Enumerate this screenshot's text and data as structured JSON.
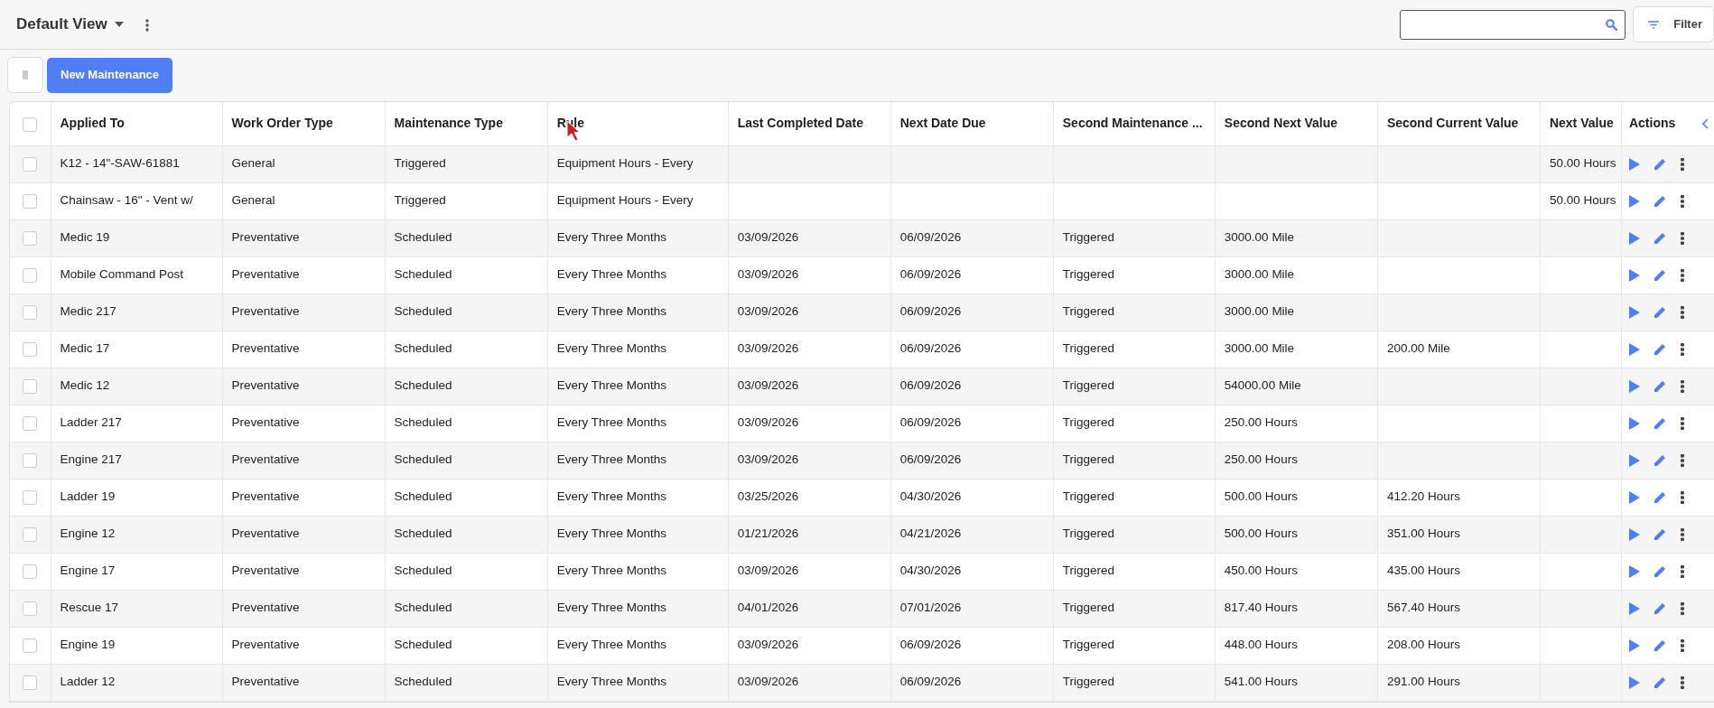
{
  "view": {
    "title": "Default View"
  },
  "filter_button": "Filter",
  "new_button": "New Maintenance",
  "table": {
    "all_selected": false,
    "columns": [
      "Applied To",
      "Work Order Type",
      "Maintenance Type",
      "Rule",
      "Last Completed Date",
      "Next Date Due",
      "Second Maintenance ...",
      "Second Next Value",
      "Second Current Value",
      "Next Value"
    ],
    "actions_header": "Actions",
    "rows": [
      {
        "selected": false,
        "cells": [
          "K12 - 14\"-SAW-61881",
          "General",
          "Triggered",
          "Equipment Hours - Every",
          null,
          null,
          null,
          null,
          null,
          "50.00 Hours"
        ]
      },
      {
        "selected": false,
        "cells": [
          "Chainsaw - 16\" - Vent w/",
          "General",
          "Triggered",
          "Equipment Hours - Every",
          null,
          null,
          null,
          null,
          null,
          "50.00 Hours"
        ]
      },
      {
        "selected": false,
        "cells": [
          "Medic 19",
          "Preventative",
          "Scheduled",
          "Every Three Months",
          "03/09/2026",
          "06/09/2026",
          "Triggered",
          "3000.00 Mile",
          null,
          null
        ]
      },
      {
        "selected": false,
        "cells": [
          "Mobile Command Post",
          "Preventative",
          "Scheduled",
          "Every Three Months",
          "03/09/2026",
          "06/09/2026",
          "Triggered",
          "3000.00 Mile",
          null,
          null
        ]
      },
      {
        "selected": false,
        "cells": [
          "Medic 217",
          "Preventative",
          "Scheduled",
          "Every Three Months",
          "03/09/2026",
          "06/09/2026",
          "Triggered",
          "3000.00 Mile",
          null,
          null
        ]
      },
      {
        "selected": false,
        "cells": [
          "Medic 17",
          "Preventative",
          "Scheduled",
          "Every Three Months",
          "03/09/2026",
          "06/09/2026",
          "Triggered",
          "3000.00 Mile",
          "200.00 Mile",
          null
        ]
      },
      {
        "selected": false,
        "cells": [
          "Medic 12",
          "Preventative",
          "Scheduled",
          "Every Three Months",
          "03/09/2026",
          "06/09/2026",
          "Triggered",
          "54000.00 Mile",
          null,
          null
        ]
      },
      {
        "selected": false,
        "cells": [
          "Ladder 217",
          "Preventative",
          "Scheduled",
          "Every Three Months",
          "03/09/2026",
          "06/09/2026",
          "Triggered",
          "250.00 Hours",
          null,
          null
        ]
      },
      {
        "selected": false,
        "cells": [
          "Engine 217",
          "Preventative",
          "Scheduled",
          "Every Three Months",
          "03/09/2026",
          "06/09/2026",
          "Triggered",
          "250.00 Hours",
          null,
          null
        ]
      },
      {
        "selected": false,
        "cells": [
          "Ladder 19",
          "Preventative",
          "Scheduled",
          "Every Three Months",
          "03/25/2026",
          "04/30/2026",
          "Triggered",
          "500.00 Hours",
          "412.20 Hours",
          null
        ]
      },
      {
        "selected": false,
        "cells": [
          "Engine 12",
          "Preventative",
          "Scheduled",
          "Every Three Months",
          "01/21/2026",
          "04/21/2026",
          "Triggered",
          "500.00 Hours",
          "351.00 Hours",
          null
        ]
      },
      {
        "selected": false,
        "cells": [
          "Engine 17",
          "Preventative",
          "Scheduled",
          "Every Three Months",
          "03/09/2026",
          "04/30/2026",
          "Triggered",
          "450.00 Hours",
          "435.00 Hours",
          null
        ]
      },
      {
        "selected": false,
        "cells": [
          "Rescue 17",
          "Preventative",
          "Scheduled",
          "Every Three Months",
          "04/01/2026",
          "07/01/2026",
          "Triggered",
          "817.40 Hours",
          "567.40 Hours",
          null
        ]
      },
      {
        "selected": false,
        "cells": [
          "Engine 19",
          "Preventative",
          "Scheduled",
          "Every Three Months",
          "03/09/2026",
          "06/09/2026",
          "Triggered",
          "448.00 Hours",
          "208.00 Hours",
          null
        ]
      },
      {
        "selected": false,
        "cells": [
          "Ladder 12",
          "Preventative",
          "Scheduled",
          "Every Three Months",
          "03/09/2026",
          "06/09/2026",
          "Triggered",
          "541.00 Hours",
          "291.00 Hours",
          null
        ]
      }
    ]
  }
}
